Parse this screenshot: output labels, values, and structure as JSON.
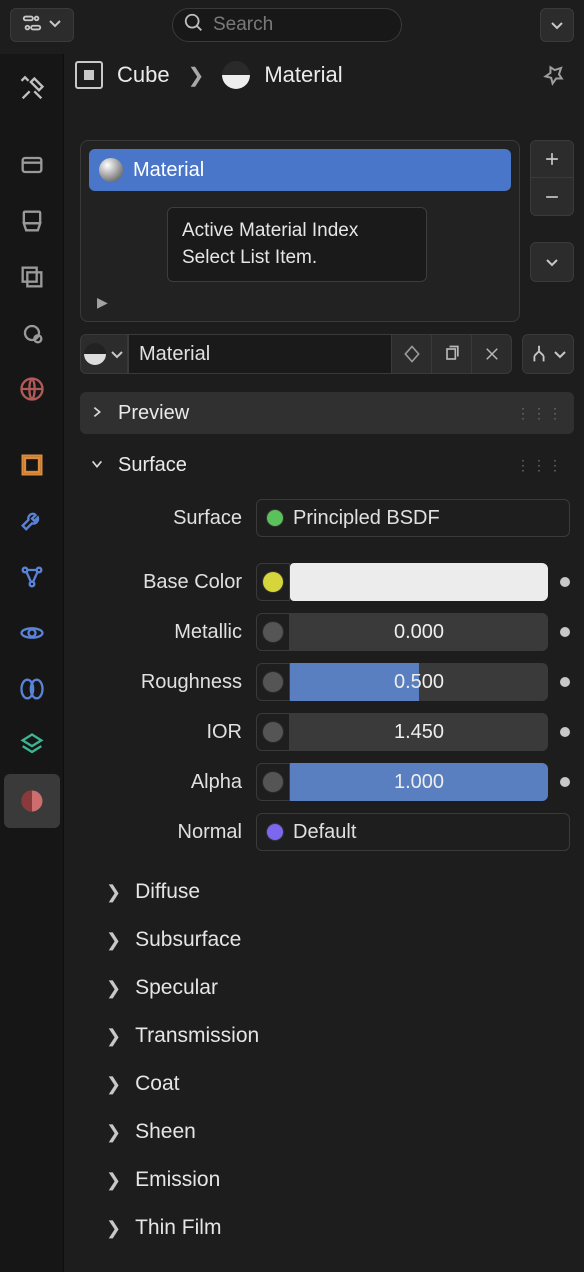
{
  "search": {
    "placeholder": "Search"
  },
  "breadcrumb": {
    "object": "Cube",
    "material": "Material"
  },
  "tabs": [
    {
      "name": "tool",
      "color": "#c8c8c8"
    },
    {
      "name": "render",
      "color": "#9a9a9a"
    },
    {
      "name": "output",
      "color": "#9a9a9a"
    },
    {
      "name": "viewlayer",
      "color": "#9a9a9a"
    },
    {
      "name": "scene",
      "color": "#9a9a9a"
    },
    {
      "name": "world",
      "color": "#b15a58"
    },
    {
      "name": "object-cube",
      "color": "#db8b3a"
    },
    {
      "name": "modifiers",
      "color": "#5a83d8"
    },
    {
      "name": "particles",
      "color": "#5a83d8"
    },
    {
      "name": "physics",
      "color": "#5a83d8"
    },
    {
      "name": "constraints",
      "color": "#5a83d8"
    },
    {
      "name": "data",
      "color": "#3db591"
    },
    {
      "name": "material-active",
      "color": "#cc6e6e",
      "active": true
    }
  ],
  "slots": {
    "active_name": "Material",
    "tooltip_line1": "Active Material Index",
    "tooltip_line2": "Select List Item."
  },
  "datablock": {
    "name": "Material"
  },
  "panels": {
    "preview_label": "Preview",
    "surface_label": "Surface"
  },
  "surface": {
    "shader_label": "Surface",
    "shader_value": "Principled BSDF",
    "base_color_label": "Base Color",
    "base_color_hex": "#ececec",
    "metallic_label": "Metallic",
    "metallic_value": "0.000",
    "metallic_fill": 0,
    "roughness_label": "Roughness",
    "roughness_value": "0.500",
    "roughness_fill": 50,
    "ior_label": "IOR",
    "ior_value": "1.450",
    "alpha_label": "Alpha",
    "alpha_value": "1.000",
    "alpha_fill": 100,
    "normal_label": "Normal",
    "normal_value": "Default"
  },
  "subpanels": [
    {
      "label": "Diffuse"
    },
    {
      "label": "Subsurface"
    },
    {
      "label": "Specular"
    },
    {
      "label": "Transmission"
    },
    {
      "label": "Coat"
    },
    {
      "label": "Sheen"
    },
    {
      "label": "Emission"
    },
    {
      "label": "Thin Film"
    }
  ]
}
